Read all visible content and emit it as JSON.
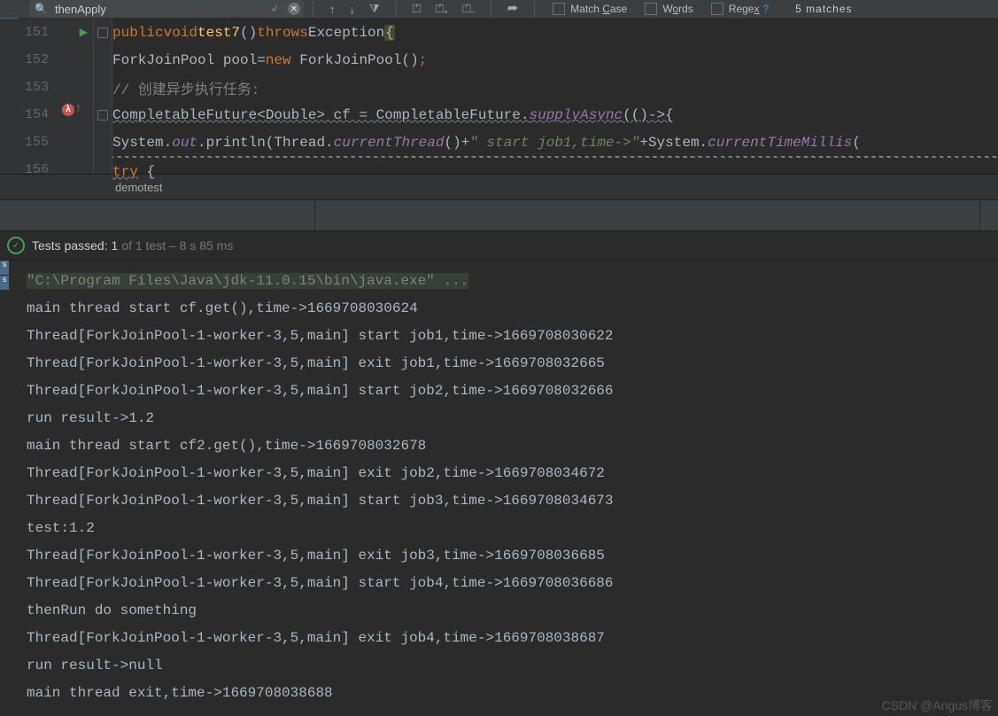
{
  "toolbar": {
    "search_value": "thenApply",
    "match_case": "Match Case",
    "words": "Words",
    "regex": "Regex",
    "matches": "5 matches"
  },
  "editor": {
    "lines": [
      "151",
      "152",
      "153",
      "154",
      "155",
      "156"
    ],
    "l151": {
      "kw_public": "public",
      "kw_void": "void",
      "method": "test7",
      "paren": "()",
      "kw_throws": "throws",
      "cls": "Exception",
      "brace": "{"
    },
    "l152": {
      "cls": "ForkJoinPool",
      "var": " pool=",
      "kw_new": "new",
      "ctor": " ForkJoinPool()",
      "semi": ";"
    },
    "l153": {
      "cmt": "// 创建异步执行任务:"
    },
    "l154": {
      "a": "CompletableFuture<Double> cf = CompletableFuture.",
      "b": "supplyAsync",
      "c": "(()->{"
    },
    "l155": {
      "a": "System.",
      "out": "out",
      "b": ".println(Thread.",
      "ct": "currentThread",
      "c": "()+",
      "str": "\" start job1,time->\"",
      "d": "+System.",
      "ctm": "currentTimeMillis",
      "e": "("
    },
    "l156": {
      "kw": "try",
      "brace": " {"
    }
  },
  "crumb": "demotest",
  "status": {
    "a": "Tests passed: 1",
    "b": " of 1 test – 8 s 85 ms"
  },
  "console": {
    "cmd": "\"C:\\Program Files\\Java\\jdk-11.0.15\\bin\\java.exe\" ...",
    "lines": [
      "main thread start cf.get(),time->1669708030624",
      "Thread[ForkJoinPool-1-worker-3,5,main] start job1,time->1669708030622",
      "Thread[ForkJoinPool-1-worker-3,5,main] exit job1,time->1669708032665",
      "Thread[ForkJoinPool-1-worker-3,5,main] start job2,time->1669708032666",
      "run result->1.2",
      "main thread start cf2.get(),time->1669708032678",
      "Thread[ForkJoinPool-1-worker-3,5,main] exit job2,time->1669708034672",
      "Thread[ForkJoinPool-1-worker-3,5,main] start job3,time->1669708034673",
      "test:1.2",
      "Thread[ForkJoinPool-1-worker-3,5,main] exit job3,time->1669708036685",
      "Thread[ForkJoinPool-1-worker-3,5,main] start job4,time->1669708036686",
      "thenRun do something",
      "Thread[ForkJoinPool-1-worker-3,5,main] exit job4,time->1669708038687",
      "run result->null",
      "main thread exit,time->1669708038688"
    ]
  },
  "watermark": "CSDN @Angus博客"
}
